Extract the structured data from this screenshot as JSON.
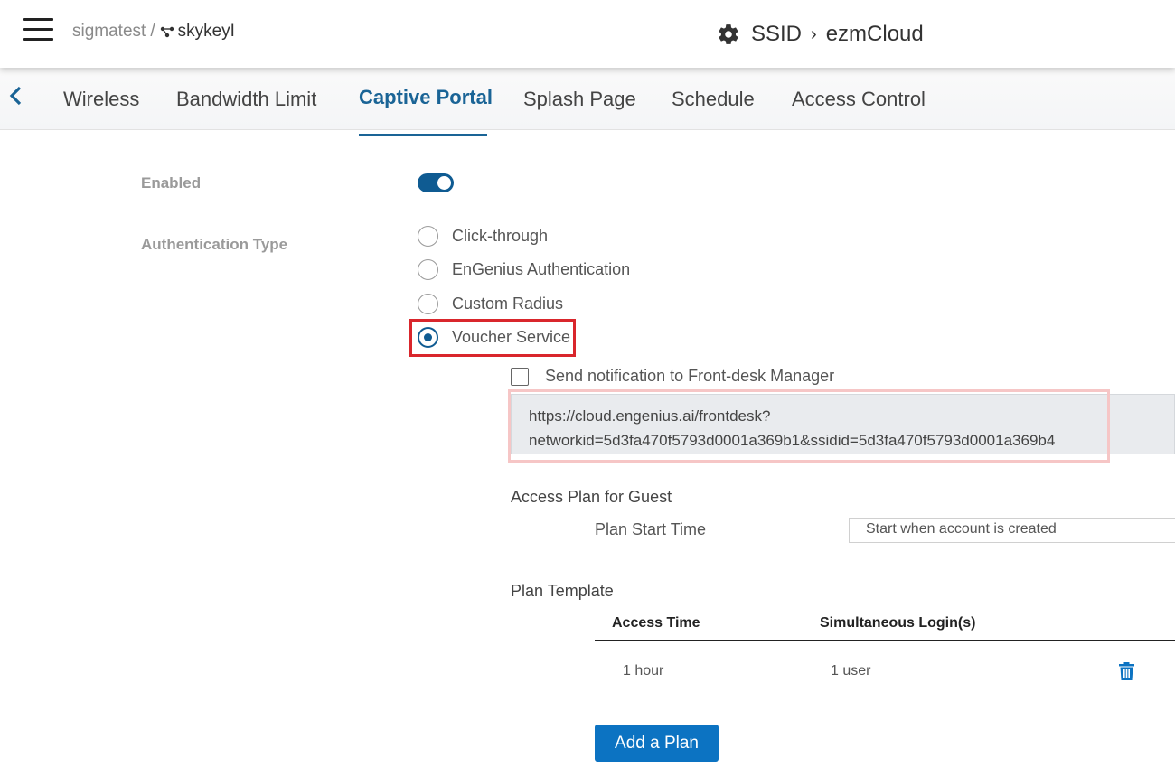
{
  "header": {
    "org": "sigmatest",
    "separator": "/",
    "network": "skykeyI",
    "section": "SSID",
    "chevron": "›",
    "ssid_name": "ezmCloud"
  },
  "tabs": [
    {
      "label": "Wireless",
      "active": false
    },
    {
      "label": "Bandwidth Limit",
      "active": false
    },
    {
      "label": "Captive Portal",
      "active": true
    },
    {
      "label": "Splash Page",
      "active": false
    },
    {
      "label": "Schedule",
      "active": false
    },
    {
      "label": "Access Control",
      "active": false
    }
  ],
  "form": {
    "enabled_label": "Enabled",
    "enabled": true,
    "auth_type_label": "Authentication Type",
    "auth_options": [
      {
        "label": "Click-through",
        "checked": false
      },
      {
        "label": "EnGenius Authentication",
        "checked": false
      },
      {
        "label": "Custom Radius",
        "checked": false
      },
      {
        "label": "Voucher Service",
        "checked": true
      }
    ],
    "notify_label": "Send notification to Front-desk Manager",
    "notify_checked": false,
    "url_line1": "https://cloud.engenius.ai/frontdesk?",
    "url_line2": "networkid=5d3fa470f5793d0001a369b1&ssidid=5d3fa470f5793d0001a369b4",
    "access_plan_label": "Access Plan for Guest",
    "plan_start_label": "Plan Start Time",
    "plan_start_value": "Start when account is created",
    "plan_template_label": "Plan Template"
  },
  "plan_table": {
    "columns": [
      "Access Time",
      "Simultaneous Login(s)"
    ],
    "rows": [
      {
        "access_time": "1 hour",
        "logins": "1 user"
      }
    ]
  },
  "add_plan_button": "Add a Plan",
  "colors": {
    "accent": "#1a6496",
    "toggle": "#0f5b92",
    "button": "#0c73c2",
    "highlight": "#d9262c"
  }
}
